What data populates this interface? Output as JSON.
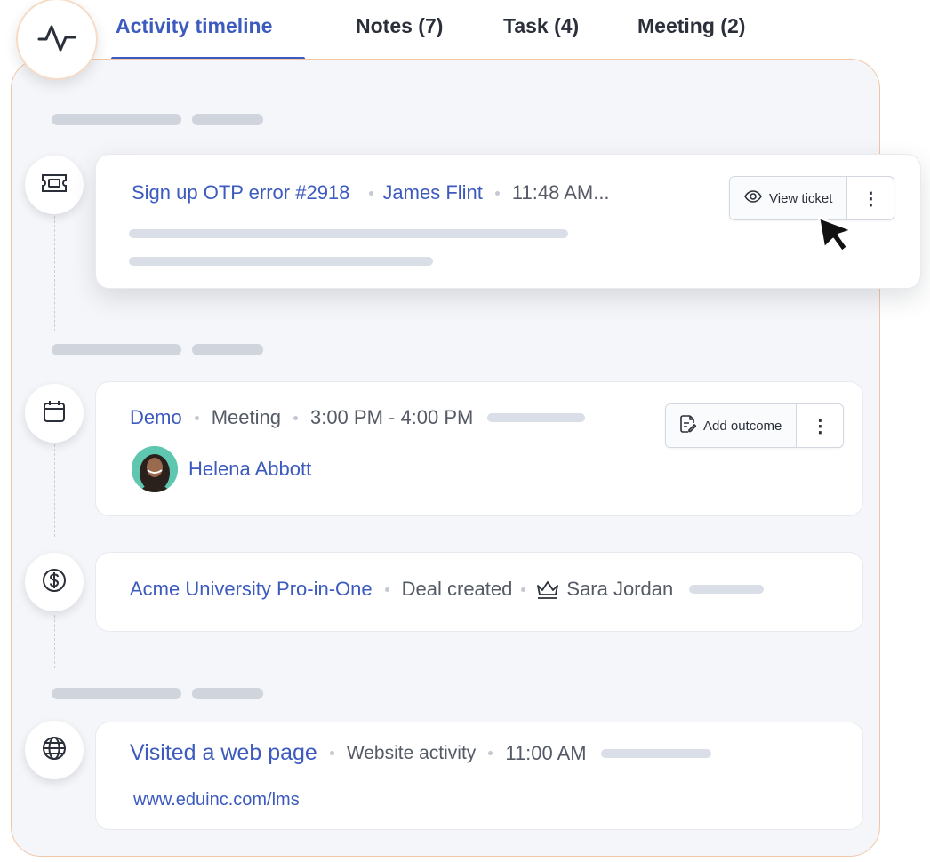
{
  "tabs": [
    {
      "label": "Activity timeline",
      "active": true
    },
    {
      "label": "Notes (7)",
      "active": false
    },
    {
      "label": "Task (4)",
      "active": false
    },
    {
      "label": "Meeting (2)",
      "active": false
    }
  ],
  "icons": {
    "logo": "activity-pulse-icon",
    "ticket": "ticket-icon",
    "meeting": "calendar-icon",
    "deal": "dollar-icon",
    "web": "globe-icon"
  },
  "colors": {
    "accent": "#3d5bbf",
    "panel_border": "#f1c6a6",
    "panel_bg": "#f5f6f9"
  },
  "timeline": {
    "ticket": {
      "title": "Sign up OTP error #2918",
      "person": "James Flint",
      "time": "11:48 AM...",
      "button_label": "View ticket",
      "more_label": "⋮"
    },
    "meeting": {
      "title": "Demo",
      "type": "Meeting",
      "time": "3:00 PM - 4:00 PM",
      "attendee": "Helena Abbott",
      "button_label": "Add outcome",
      "more_label": "⋮"
    },
    "deal": {
      "title": "Acme University Pro-in-One",
      "status": "Deal created",
      "owner": "Sara Jordan"
    },
    "web": {
      "title": "Visited a web page",
      "type": "Website activity",
      "time": "11:00 AM",
      "url": "www.eduinc.com/lms"
    }
  }
}
